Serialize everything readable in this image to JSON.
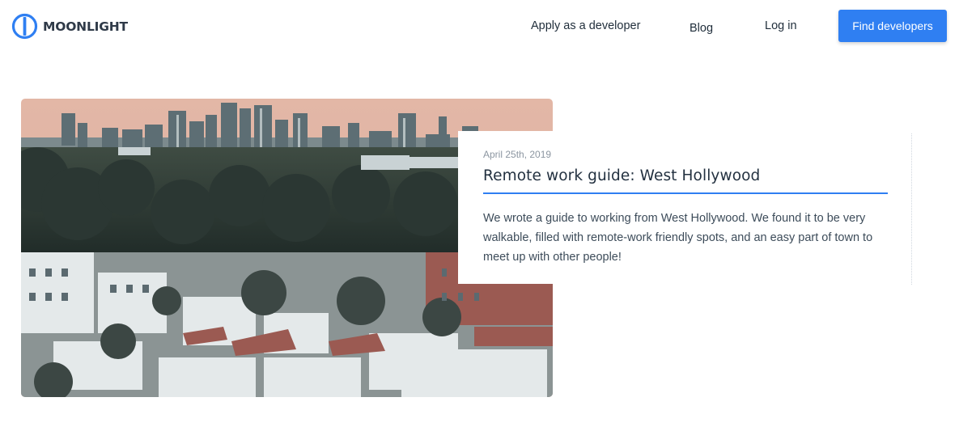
{
  "brand": {
    "name": "MOONLIGHT",
    "logo_icon": "moonlight-ring-icon",
    "accent": "#2f7ff2"
  },
  "nav": {
    "apply": "Apply as a developer",
    "blog": "Blog",
    "login": "Log in",
    "cta": "Find developers"
  },
  "post": {
    "image": "city-skyline-photo",
    "date": "April 25th, 2019",
    "title": "Remote work guide: West Hollywood",
    "excerpt": "We wrote a guide to working from West Hollywood. We found it to be very walkable, filled with remote-work friendly spots, and an easy part of town to meet up with other people!"
  }
}
